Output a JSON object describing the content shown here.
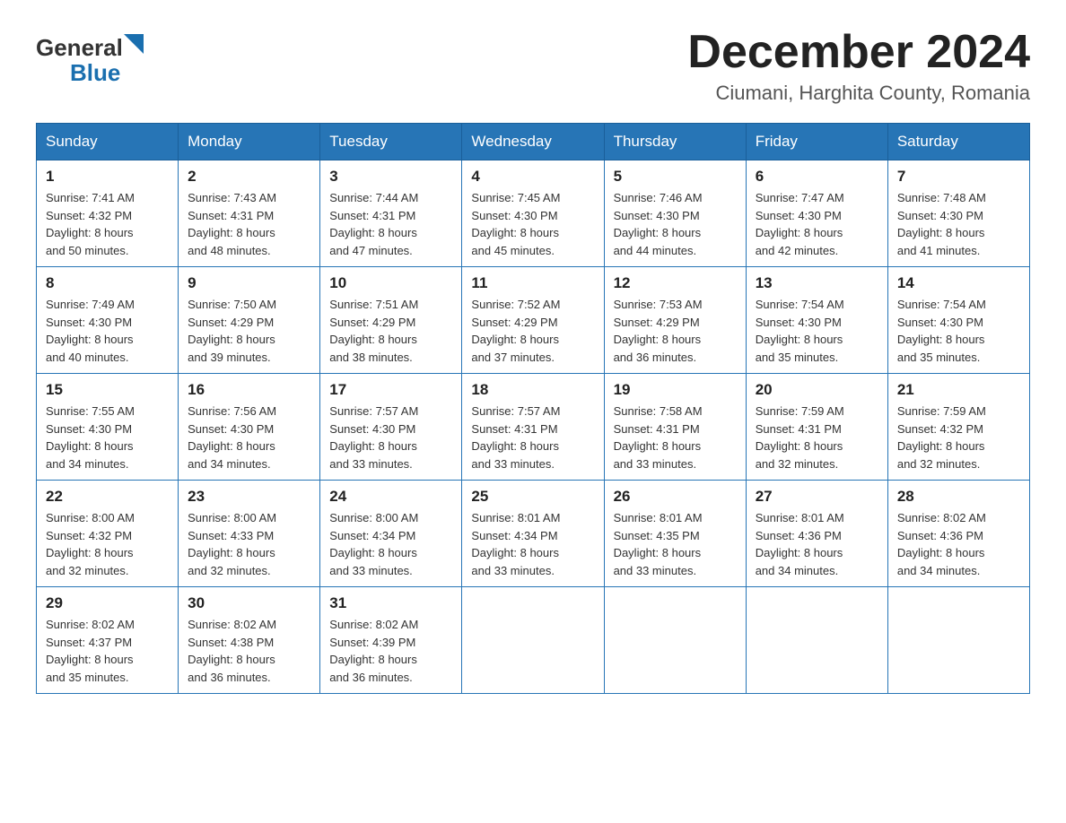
{
  "header": {
    "logo_text_general": "General",
    "logo_text_blue": "Blue",
    "title": "December 2024",
    "location": "Ciumani, Harghita County, Romania"
  },
  "weekdays": [
    "Sunday",
    "Monday",
    "Tuesday",
    "Wednesday",
    "Thursday",
    "Friday",
    "Saturday"
  ],
  "weeks": [
    [
      {
        "day": "1",
        "sunrise": "7:41 AM",
        "sunset": "4:32 PM",
        "daylight": "8 hours and 50 minutes."
      },
      {
        "day": "2",
        "sunrise": "7:43 AM",
        "sunset": "4:31 PM",
        "daylight": "8 hours and 48 minutes."
      },
      {
        "day": "3",
        "sunrise": "7:44 AM",
        "sunset": "4:31 PM",
        "daylight": "8 hours and 47 minutes."
      },
      {
        "day": "4",
        "sunrise": "7:45 AM",
        "sunset": "4:30 PM",
        "daylight": "8 hours and 45 minutes."
      },
      {
        "day": "5",
        "sunrise": "7:46 AM",
        "sunset": "4:30 PM",
        "daylight": "8 hours and 44 minutes."
      },
      {
        "day": "6",
        "sunrise": "7:47 AM",
        "sunset": "4:30 PM",
        "daylight": "8 hours and 42 minutes."
      },
      {
        "day": "7",
        "sunrise": "7:48 AM",
        "sunset": "4:30 PM",
        "daylight": "8 hours and 41 minutes."
      }
    ],
    [
      {
        "day": "8",
        "sunrise": "7:49 AM",
        "sunset": "4:30 PM",
        "daylight": "8 hours and 40 minutes."
      },
      {
        "day": "9",
        "sunrise": "7:50 AM",
        "sunset": "4:29 PM",
        "daylight": "8 hours and 39 minutes."
      },
      {
        "day": "10",
        "sunrise": "7:51 AM",
        "sunset": "4:29 PM",
        "daylight": "8 hours and 38 minutes."
      },
      {
        "day": "11",
        "sunrise": "7:52 AM",
        "sunset": "4:29 PM",
        "daylight": "8 hours and 37 minutes."
      },
      {
        "day": "12",
        "sunrise": "7:53 AM",
        "sunset": "4:29 PM",
        "daylight": "8 hours and 36 minutes."
      },
      {
        "day": "13",
        "sunrise": "7:54 AM",
        "sunset": "4:30 PM",
        "daylight": "8 hours and 35 minutes."
      },
      {
        "day": "14",
        "sunrise": "7:54 AM",
        "sunset": "4:30 PM",
        "daylight": "8 hours and 35 minutes."
      }
    ],
    [
      {
        "day": "15",
        "sunrise": "7:55 AM",
        "sunset": "4:30 PM",
        "daylight": "8 hours and 34 minutes."
      },
      {
        "day": "16",
        "sunrise": "7:56 AM",
        "sunset": "4:30 PM",
        "daylight": "8 hours and 34 minutes."
      },
      {
        "day": "17",
        "sunrise": "7:57 AM",
        "sunset": "4:30 PM",
        "daylight": "8 hours and 33 minutes."
      },
      {
        "day": "18",
        "sunrise": "7:57 AM",
        "sunset": "4:31 PM",
        "daylight": "8 hours and 33 minutes."
      },
      {
        "day": "19",
        "sunrise": "7:58 AM",
        "sunset": "4:31 PM",
        "daylight": "8 hours and 33 minutes."
      },
      {
        "day": "20",
        "sunrise": "7:59 AM",
        "sunset": "4:31 PM",
        "daylight": "8 hours and 32 minutes."
      },
      {
        "day": "21",
        "sunrise": "7:59 AM",
        "sunset": "4:32 PM",
        "daylight": "8 hours and 32 minutes."
      }
    ],
    [
      {
        "day": "22",
        "sunrise": "8:00 AM",
        "sunset": "4:32 PM",
        "daylight": "8 hours and 32 minutes."
      },
      {
        "day": "23",
        "sunrise": "8:00 AM",
        "sunset": "4:33 PM",
        "daylight": "8 hours and 32 minutes."
      },
      {
        "day": "24",
        "sunrise": "8:00 AM",
        "sunset": "4:34 PM",
        "daylight": "8 hours and 33 minutes."
      },
      {
        "day": "25",
        "sunrise": "8:01 AM",
        "sunset": "4:34 PM",
        "daylight": "8 hours and 33 minutes."
      },
      {
        "day": "26",
        "sunrise": "8:01 AM",
        "sunset": "4:35 PM",
        "daylight": "8 hours and 33 minutes."
      },
      {
        "day": "27",
        "sunrise": "8:01 AM",
        "sunset": "4:36 PM",
        "daylight": "8 hours and 34 minutes."
      },
      {
        "day": "28",
        "sunrise": "8:02 AM",
        "sunset": "4:36 PM",
        "daylight": "8 hours and 34 minutes."
      }
    ],
    [
      {
        "day": "29",
        "sunrise": "8:02 AM",
        "sunset": "4:37 PM",
        "daylight": "8 hours and 35 minutes."
      },
      {
        "day": "30",
        "sunrise": "8:02 AM",
        "sunset": "4:38 PM",
        "daylight": "8 hours and 36 minutes."
      },
      {
        "day": "31",
        "sunrise": "8:02 AM",
        "sunset": "4:39 PM",
        "daylight": "8 hours and 36 minutes."
      },
      null,
      null,
      null,
      null
    ]
  ],
  "labels": {
    "sunrise": "Sunrise:",
    "sunset": "Sunset:",
    "daylight": "Daylight:"
  }
}
